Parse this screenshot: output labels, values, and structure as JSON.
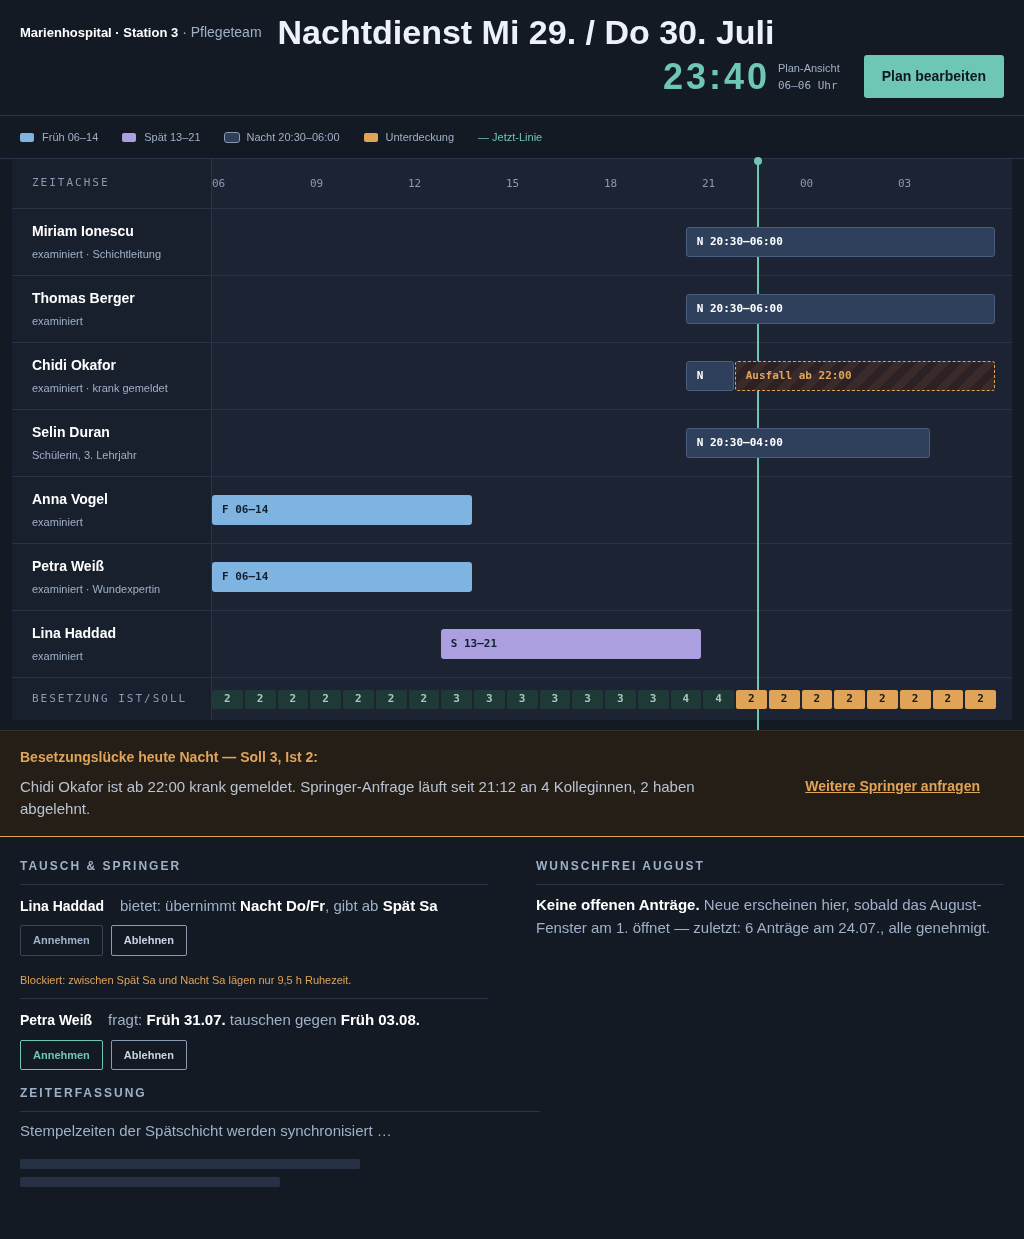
{
  "header": {
    "brand": "Marienhospital · Station 3",
    "team": "· Pflegeteam",
    "title": "Nachtdienst Mi 29. / Do 30. Juli",
    "clock": "23:40",
    "view_label": "Plan-Ansicht",
    "view_range": "06–06 Uhr",
    "edit_button": "Plan bearbeiten"
  },
  "legend": [
    {
      "kind": "early",
      "label": "Früh 06–14",
      "color": "#7fb3e0"
    },
    {
      "kind": "late",
      "label": "Spät 13–21",
      "color": "#ab9fe0"
    },
    {
      "kind": "night",
      "label": "Nacht 20:30–06:00",
      "color": "#2f405c"
    },
    {
      "kind": "outage",
      "label": "Unterdeckung",
      "color": "#e0a458"
    },
    {
      "kind": "now_line",
      "label": "— Jetzt-Linie",
      "color": "#6ec6b4"
    }
  ],
  "timeline": {
    "axis_label": "ZEITACHSE",
    "hours": [
      "06",
      "09",
      "12",
      "15",
      "18",
      "21",
      "00",
      "03"
    ],
    "staff": [
      {
        "name": "Miriam Ionescu",
        "role": "examiniert · Schichtleitung",
        "bars": [
          {
            "kind": "night",
            "code": "N",
            "time": "20:30–06:00"
          }
        ]
      },
      {
        "name": "Thomas Berger",
        "role": "examiniert",
        "bars": [
          {
            "kind": "night",
            "code": "N",
            "time": "20:30–06:00"
          }
        ]
      },
      {
        "name": "Chidi Okafor",
        "role": "examiniert · krank gemeldet",
        "bars": [
          {
            "kind": "night",
            "code": "N"
          },
          {
            "kind": "outage",
            "code": "Ausfall ab",
            "time": "22:00"
          }
        ]
      },
      {
        "name": "Selin Duran",
        "role": "Schülerin, 3. Lehrjahr",
        "bars": [
          {
            "kind": "night",
            "code": "N",
            "time": "20:30–04:00"
          }
        ]
      },
      {
        "name": "Anna Vogel",
        "role": "examiniert",
        "bars": [
          {
            "kind": "early",
            "code": "F",
            "time": "06–14"
          }
        ]
      },
      {
        "name": "Petra Weiß",
        "role": "examiniert · Wundexpertin",
        "bars": [
          {
            "kind": "early",
            "code": "F",
            "time": "06–14"
          }
        ]
      },
      {
        "name": "Lina Haddad",
        "role": "examiniert",
        "bars": [
          {
            "kind": "late",
            "code": "S",
            "time": "13–21"
          }
        ]
      }
    ],
    "coverage_label": "BESETZUNG IST/SOLL",
    "coverage": [
      {
        "value": "2",
        "short": false
      },
      {
        "value": "2",
        "short": false
      },
      {
        "value": "2",
        "short": false
      },
      {
        "value": "2",
        "short": false
      },
      {
        "value": "2",
        "short": false
      },
      {
        "value": "2",
        "short": false
      },
      {
        "value": "2",
        "short": false
      },
      {
        "value": "3",
        "short": false
      },
      {
        "value": "3",
        "short": false
      },
      {
        "value": "3",
        "short": false
      },
      {
        "value": "3",
        "short": false
      },
      {
        "value": "3",
        "short": false
      },
      {
        "value": "3",
        "short": false
      },
      {
        "value": "3",
        "short": false
      },
      {
        "value": "4",
        "short": false
      },
      {
        "value": "4",
        "short": false
      },
      {
        "value": "2",
        "short": true
      },
      {
        "value": "2",
        "short": true
      },
      {
        "value": "2",
        "short": true
      },
      {
        "value": "2",
        "short": true
      },
      {
        "value": "2",
        "short": true
      },
      {
        "value": "2",
        "short": true
      },
      {
        "value": "2",
        "short": true
      },
      {
        "value": "2",
        "short": true
      }
    ]
  },
  "alert": {
    "title": "Besetzungslücke heute Nacht — Soll 3, Ist 2:",
    "text": "Chidi Okafor ist ab 22:00 krank gemeldet. Springer-Anfrage läuft seit 21:12 an 4 Kolleginnen, 2 haben abgelehnt.",
    "link": "Weitere Springer anfragen"
  },
  "swaps": {
    "heading": "TAUSCH & SPRINGER",
    "requests": [
      {
        "name": "Lina Haddad",
        "text": "bietet: übernimmt **Nacht Do/Fr**, gibt ab **Spät Sa**",
        "accept": "Annehmen",
        "accept_enabled": false,
        "decline": "Ablehnen",
        "warning": "Blockiert: zwischen Spät Sa und Nacht Sa lägen nur 9,5 h Ruhezeit."
      },
      {
        "name": "Petra Weiß",
        "text": "fragt: **Früh 31.07.** tauschen gegen **Früh 03.08.**",
        "accept": "Annehmen",
        "accept_enabled": true,
        "decline": "Ablehnen"
      }
    ]
  },
  "time_tracking": {
    "heading": "ZEITERFASSUNG",
    "text": "Stempelzeiten der Spätschicht werden synchronisiert …"
  },
  "wishes": {
    "heading": "WUNSCHFREI AUGUST",
    "text": "**Keine offenen Anträge.** Neue erscheinen hier, sobald das August-Fenster am 1. öffnet — zuletzt: 6 Anträge am 24.07., alle genehmigt."
  }
}
